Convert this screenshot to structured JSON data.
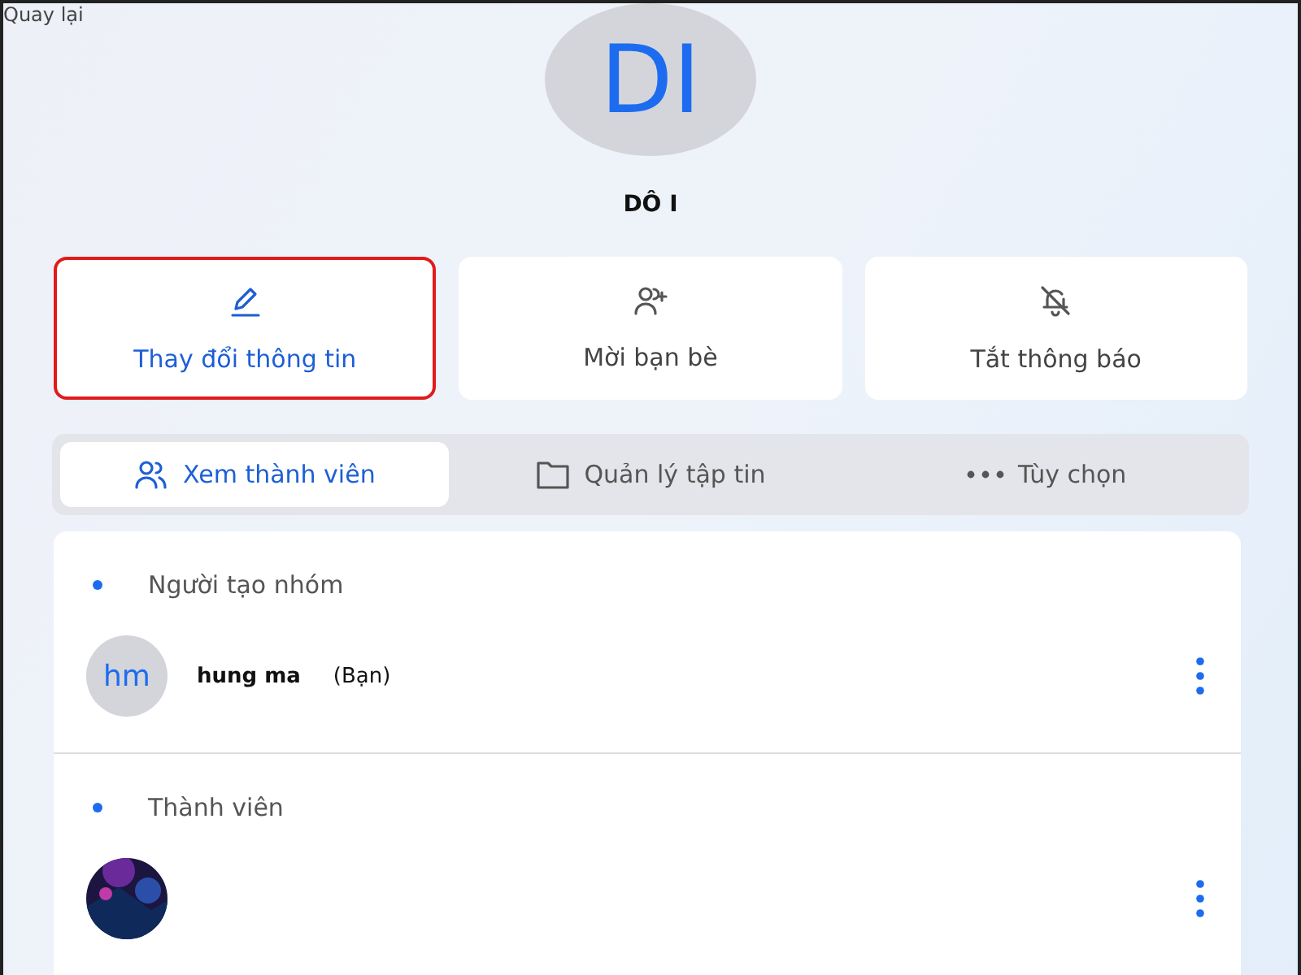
{
  "back_link": "Quay lại",
  "group": {
    "avatar_initials": "DI",
    "name": "DÔ I"
  },
  "actions": [
    {
      "kind": "edit",
      "label": "Thay đổi thông tin",
      "highlighted": true
    },
    {
      "kind": "invite",
      "label": "Mời bạn bè",
      "highlighted": false
    },
    {
      "kind": "mute",
      "label": "Tắt thông báo",
      "highlighted": false
    }
  ],
  "tabs": [
    {
      "kind": "members",
      "label": "Xem thành viên",
      "selected": true
    },
    {
      "kind": "files",
      "label": "Quản lý tập tin",
      "selected": false
    },
    {
      "kind": "options",
      "label": "Tùy chọn",
      "selected": false
    }
  ],
  "sections": [
    {
      "title": "Người tạo nhóm",
      "members": [
        {
          "avatar": {
            "kind": "initials",
            "text": "hm"
          },
          "name": "hung ma",
          "tag": "(Bạn)"
        }
      ]
    },
    {
      "title": "Thành viên"
    }
  ]
}
